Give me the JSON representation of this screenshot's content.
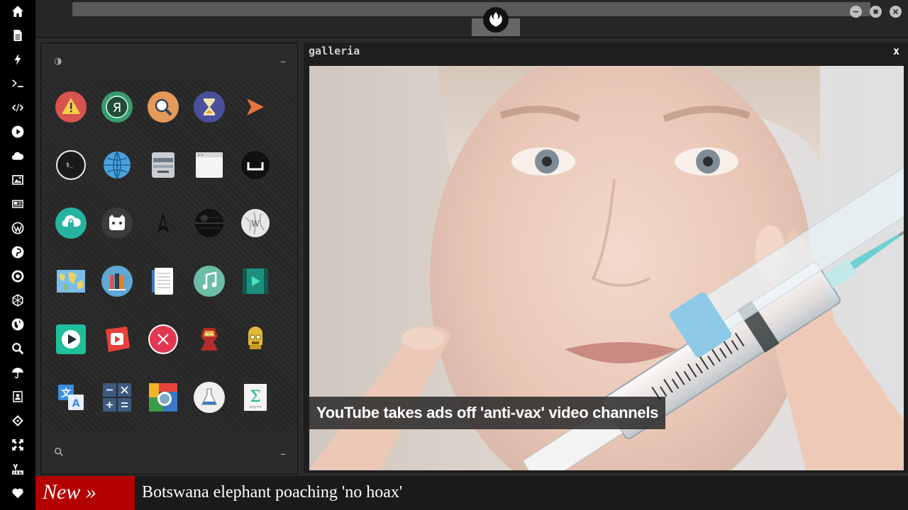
{
  "sidebar": {
    "items": [
      {
        "icon": "home-icon"
      },
      {
        "icon": "document-icon"
      },
      {
        "icon": "bolt-icon"
      },
      {
        "icon": "terminal-icon"
      },
      {
        "icon": "code-icon"
      },
      {
        "icon": "play-icon"
      },
      {
        "icon": "cloud-icon"
      },
      {
        "icon": "image-icon"
      },
      {
        "icon": "newspaper-icon"
      },
      {
        "icon": "wordpress-icon"
      },
      {
        "icon": "pinterest-icon"
      },
      {
        "icon": "rebel-icon"
      },
      {
        "icon": "network-icon"
      },
      {
        "icon": "globe-icon"
      },
      {
        "icon": "search-icon"
      },
      {
        "icon": "umbrella-icon"
      },
      {
        "icon": "contact-icon"
      },
      {
        "icon": "git-icon"
      },
      {
        "icon": "expand-icon"
      },
      {
        "icon": "youtube-icon"
      },
      {
        "icon": "heart-icon"
      }
    ]
  },
  "topbar": {
    "logo": "rebel-alliance-logo",
    "buttons": [
      "minimize-icon",
      "maximize-icon",
      "close-icon"
    ]
  },
  "launcher": {
    "header_icon": "contrast-icon",
    "header_minimize": "–",
    "footer_icon": "search-icon",
    "footer_minimize": "–",
    "apps": [
      [
        "warning-app-icon",
        "yandex-app-icon",
        "search-app-icon",
        "hourglass-app-icon",
        "forward-app-icon"
      ],
      [
        "terminal-app-icon",
        "globe-app-icon",
        "scanner-app-icon",
        "window-app-icon",
        "keyboard-app-icon"
      ],
      [
        "cloud-lock-app-icon",
        "github-app-icon",
        "starfleet-app-icon",
        "death-star-app-icon",
        "wikipedia-app-icon"
      ],
      [
        "map-app-icon",
        "books-app-icon",
        "notes-app-icon",
        "music-app-icon",
        "video-app-icon"
      ],
      [
        "play-app-icon",
        "youtube-app-icon",
        "close-app-icon",
        "iron-man-app-icon",
        "c3po-app-icon"
      ],
      [
        "translate-app-icon",
        "calculator-app-icon",
        "photos-app-icon",
        "lab-app-icon",
        "formula-app-icon"
      ]
    ]
  },
  "gallery": {
    "title": "galleria",
    "close_label": "x",
    "caption": "YouTube takes ads off 'anti-vax' video channels"
  },
  "ticker": {
    "label": "New »",
    "headline": "Botswana elephant poaching 'no hoax'"
  }
}
